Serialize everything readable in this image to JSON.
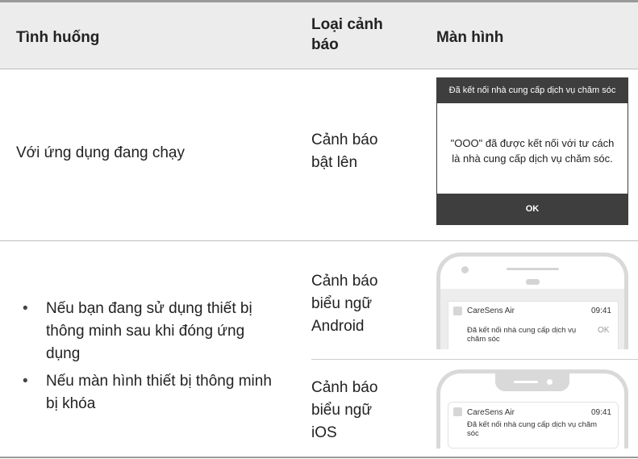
{
  "table": {
    "headers": {
      "situation": "Tình huống",
      "alert_type_line1": "Loại cảnh",
      "alert_type_line2": "báo",
      "screen": "Màn hình"
    },
    "row1": {
      "situation": "Với ứng dụng đang chạy",
      "alert_type_line1": "Cảnh báo",
      "alert_type_line2": "bật lên",
      "dialog": {
        "title": "Đã kết nối nhà cung cấp dịch vụ chăm sóc",
        "message_line1": "\"OOO\" đã được kết nối với tư cách",
        "message_line2": "là nhà cung cấp dịch vụ chăm sóc.",
        "ok": "OK"
      }
    },
    "row2": {
      "bullets": [
        {
          "line1": "Nếu bạn đang sử dụng thiết bị",
          "line2": "thông minh sau khi đóng ứng",
          "line3": "dụng"
        },
        {
          "line1": "Nếu màn hình thiết bị thông minh",
          "line2": "bị khóa"
        }
      ],
      "bullet_symbol": "•",
      "android": {
        "type_line1": "Cảnh báo",
        "type_line2": "biểu ngữ",
        "type_line3": "Android",
        "app": "CareSens Air",
        "time": "09:41",
        "msg_line1": "Đã kết nối nhà cung cấp dịch vụ",
        "msg_line2": "chăm sóc",
        "ok": "OK"
      },
      "ios": {
        "type_line1": "Cảnh báo",
        "type_line2": "biểu ngữ",
        "type_line3": "iOS",
        "app": "CareSens Air",
        "time": "09:41",
        "msg_line1": "Đã kết nối nhà cung cấp dịch vụ chăm",
        "msg_line2": "sóc"
      }
    }
  },
  "colors": {
    "header_bg": "#ececec",
    "dialog_dark": "#3e3e3e",
    "phone_frame": "#d9d9d9"
  }
}
